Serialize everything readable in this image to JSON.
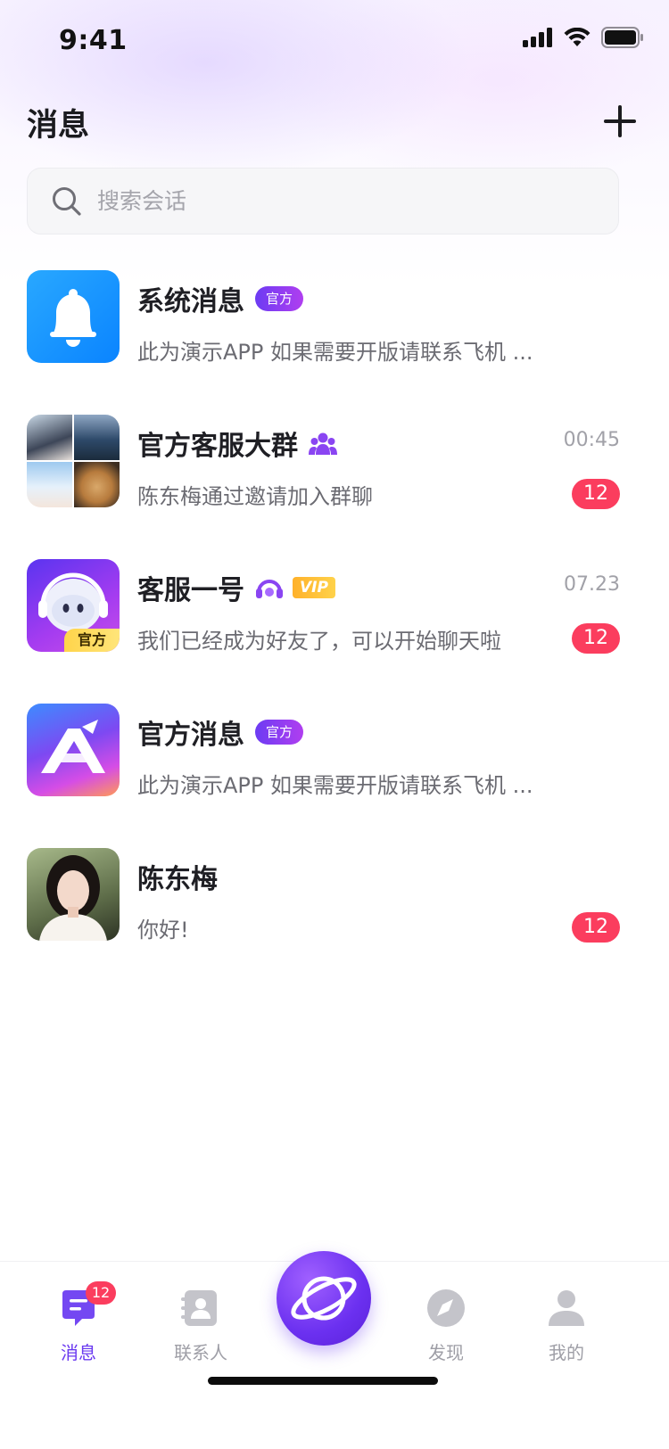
{
  "status_bar": {
    "time": "9:41"
  },
  "header": {
    "title": "消息",
    "add_icon": "plus-icon"
  },
  "search": {
    "placeholder": "搜索会话",
    "icon": "search-icon"
  },
  "conversations": [
    {
      "name": "系统消息",
      "tag": "官方",
      "message": "此为演示APP 如果需要开版请联系飞机 ...",
      "time": "",
      "unread": "",
      "avatar": "bell-avatar"
    },
    {
      "name": "官方客服大群",
      "tag": "",
      "message": "陈东梅通过邀请加入群聊",
      "time": "00:45",
      "unread": "12",
      "avatar": "group-photo-grid"
    },
    {
      "name": "客服一号",
      "tag": "VIP",
      "message": "我们已经成为好友了，可以开始聊天啦",
      "time": "07.23",
      "unread": "12",
      "avatar": "robot-avatar",
      "avatar_tag": "官方"
    },
    {
      "name": "官方消息",
      "tag": "官方",
      "message": "此为演示APP 如果需要开版请联系飞机 ...",
      "time": "",
      "unread": "",
      "avatar": "app-logo-avatar"
    },
    {
      "name": "陈东梅",
      "tag": "",
      "message": "你好!",
      "time": "",
      "unread": "12",
      "avatar": "portrait-avatar"
    }
  ],
  "tabbar": {
    "tabs": [
      {
        "label": "消息",
        "icon": "message-icon",
        "badge": "12",
        "active": true
      },
      {
        "label": "联系人",
        "icon": "contacts-icon"
      },
      {
        "label": "",
        "icon": "planet-icon"
      },
      {
        "label": "发现",
        "icon": "compass-icon"
      },
      {
        "label": "我的",
        "icon": "profile-icon"
      }
    ]
  },
  "colors": {
    "accent": "#6a39f0",
    "badge": "#fb3d5e",
    "official_tag": "#7b3cf2",
    "vip": "#ffb12a"
  }
}
